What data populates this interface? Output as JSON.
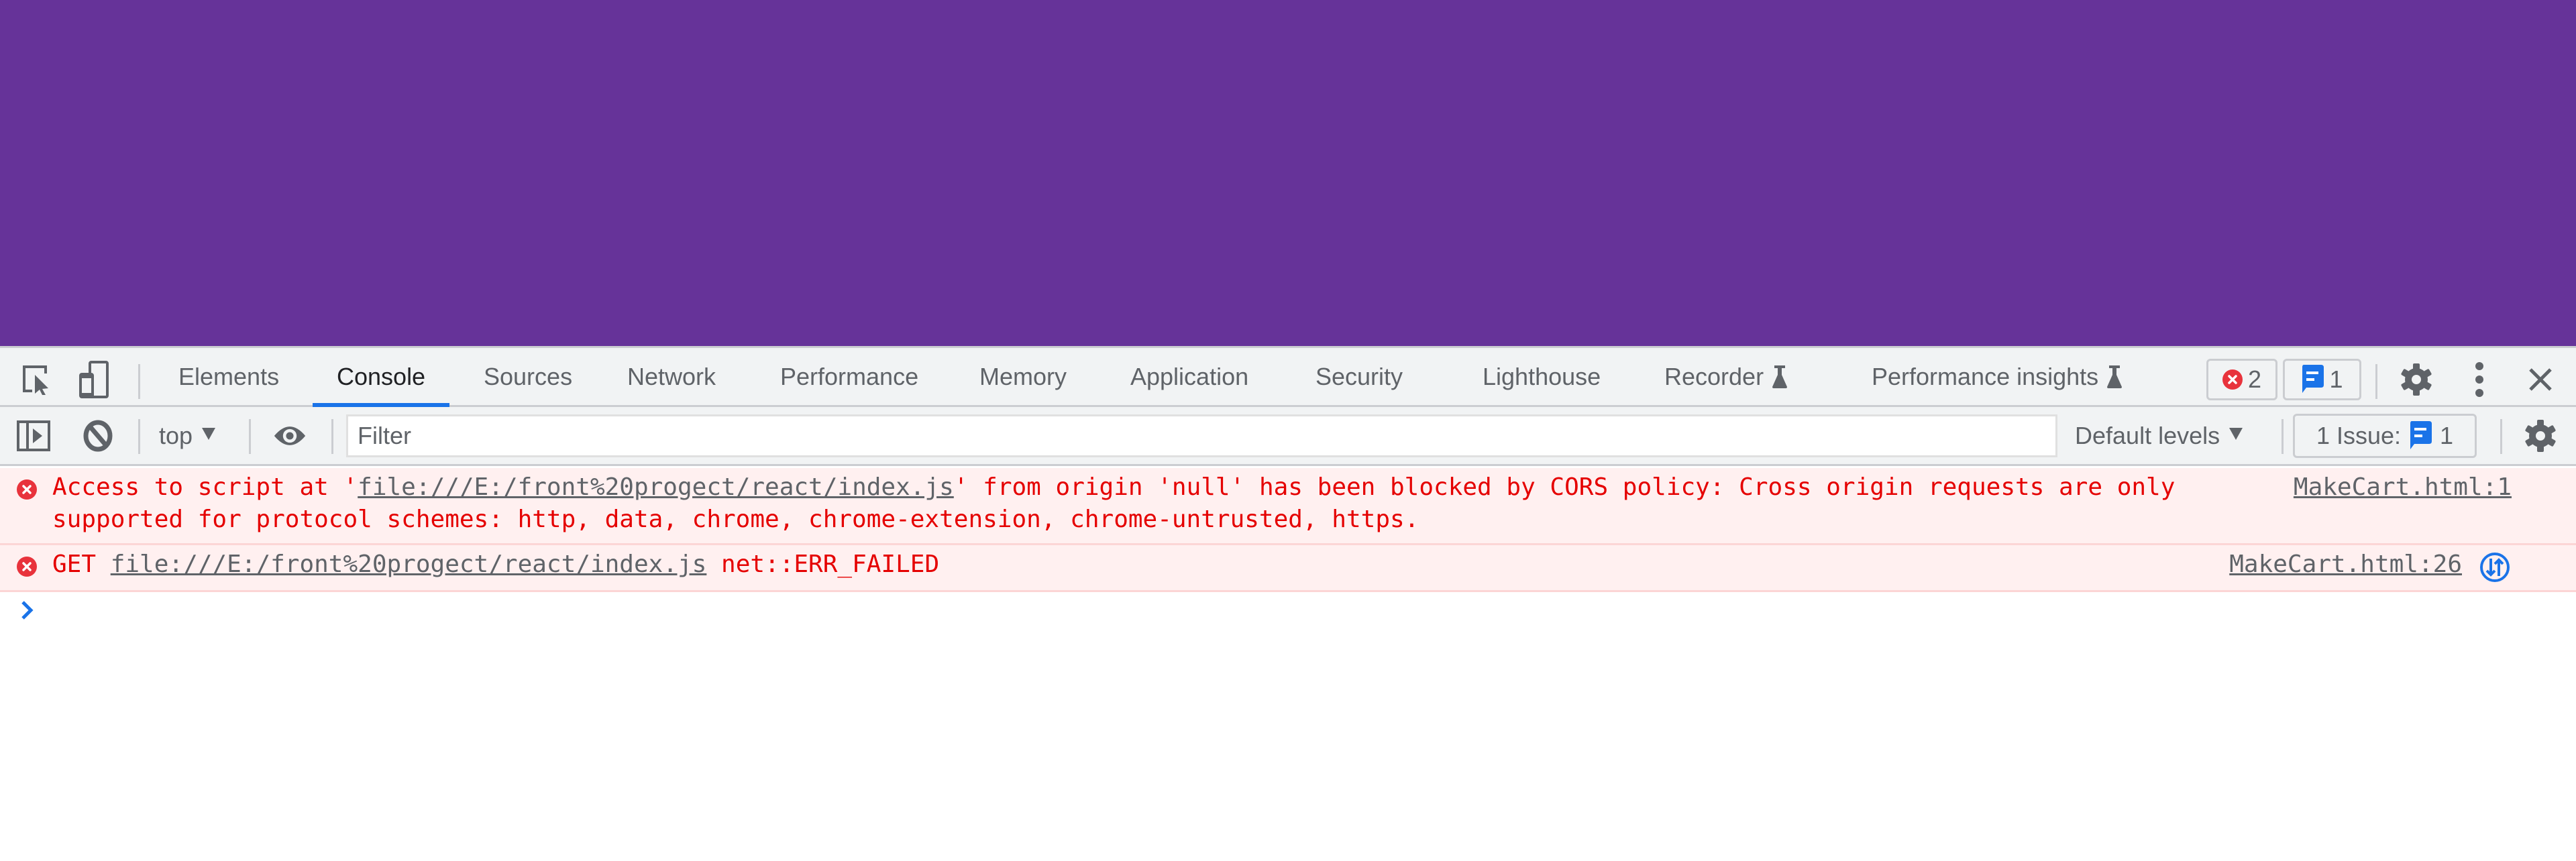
{
  "page": {
    "background_color": "#663399"
  },
  "devtools": {
    "tabs": [
      {
        "label": "Elements",
        "active": false
      },
      {
        "label": "Console",
        "active": true
      },
      {
        "label": "Sources",
        "active": false
      },
      {
        "label": "Network",
        "active": false
      },
      {
        "label": "Performance",
        "active": false
      },
      {
        "label": "Memory",
        "active": false
      },
      {
        "label": "Application",
        "active": false
      },
      {
        "label": "Security",
        "active": false
      },
      {
        "label": "Lighthouse",
        "active": false
      },
      {
        "label": "Recorder",
        "active": false,
        "experimental": true
      },
      {
        "label": "Performance insights",
        "active": false,
        "experimental": true
      }
    ],
    "error_count": "2",
    "info_count": "1",
    "accent_color": "#1a73e8",
    "error_color": "#e8333c"
  },
  "console_toolbar": {
    "context": "top",
    "filter_placeholder": "Filter",
    "filter_value": "",
    "levels": "Default levels",
    "issues_label": "1 Issue:",
    "issues_count": "1"
  },
  "messages": [
    {
      "level": "error",
      "prefix": "Access to script at '",
      "url": "file:///E:/front%20progect/react/index.js",
      "suffix": "' from origin 'null' has been blocked by CORS policy: Cross origin requests are only supported for protocol schemes: http, data, chrome, chrome-extension, chrome-untrusted, https.",
      "source": "MakeCart.html:1"
    },
    {
      "level": "error",
      "prefix": "GET ",
      "url": "file:///E:/front%20progect/react/index.js",
      "suffix": " net::ERR_FAILED",
      "source": "MakeCart.html:26"
    }
  ]
}
